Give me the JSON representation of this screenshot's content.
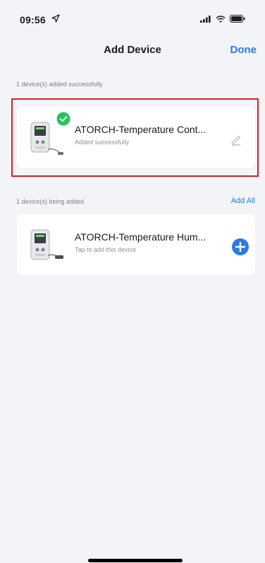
{
  "status_bar": {
    "time": "09:56",
    "icons": [
      "location-arrow-icon",
      "cellular-icon",
      "wifi-icon",
      "battery-icon"
    ]
  },
  "nav": {
    "title": "Add Device",
    "done_label": "Done"
  },
  "sections": {
    "added_label": "1 device(s) added successfully",
    "adding_label": "1 device(s) being added",
    "add_all_label": "Add All"
  },
  "added_devices": [
    {
      "name": "ATORCH-Temperature Cont...",
      "status": "Added successfully",
      "icon": "edit-icon"
    }
  ],
  "pending_devices": [
    {
      "name": "ATORCH-Temperature Hum...",
      "status": "Tap to add this device",
      "icon": "add-circle-icon"
    }
  ],
  "colors": {
    "accent": "#2a7be4",
    "success": "#22c55e",
    "highlight": "#d8202a",
    "background": "#f3f4f7"
  }
}
